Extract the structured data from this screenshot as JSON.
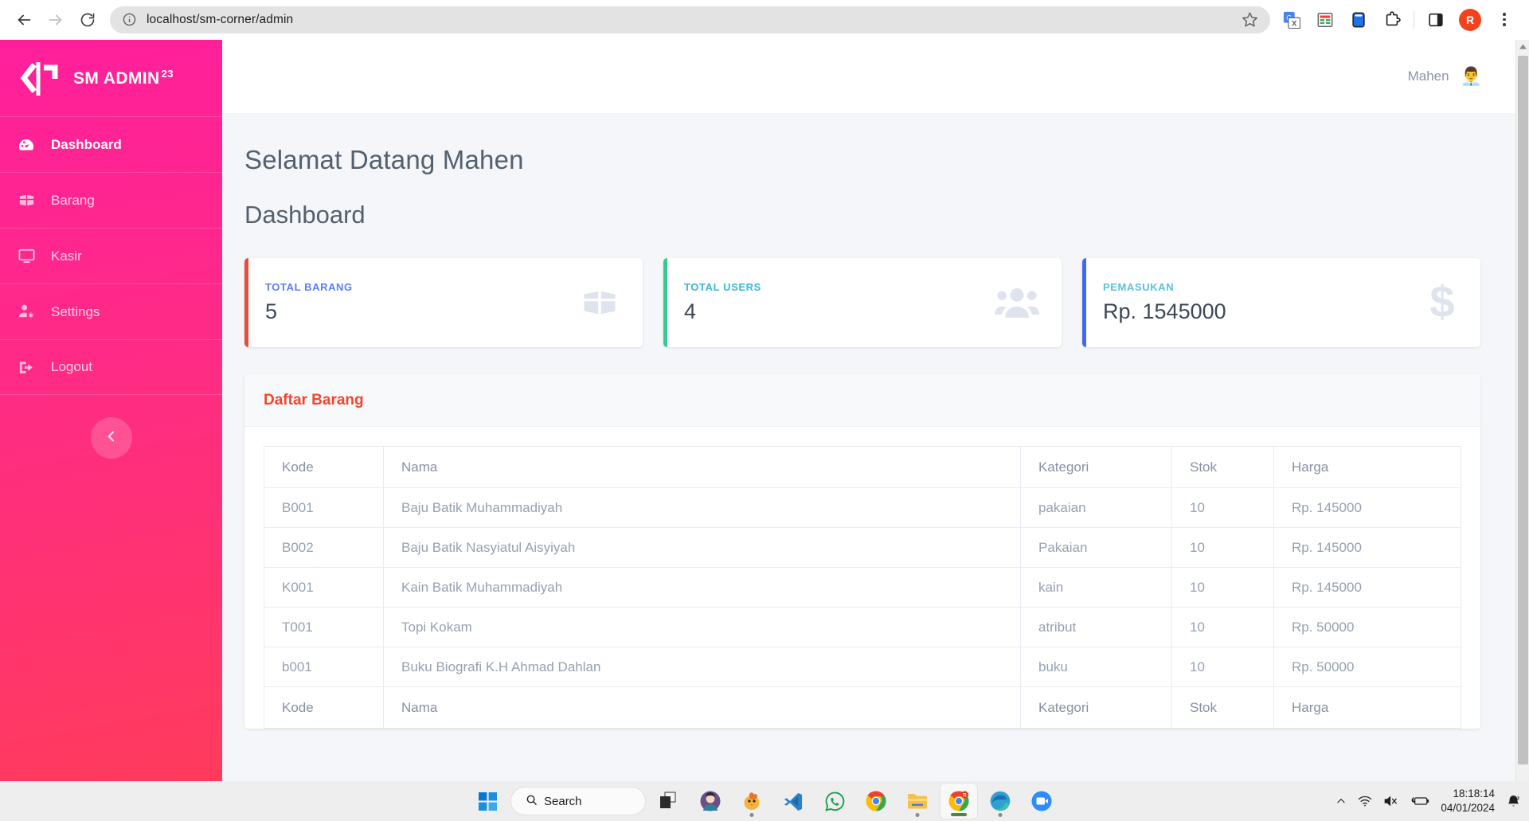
{
  "browser": {
    "url": "localhost/sm-corner/admin",
    "back_icon": "back-arrow-icon",
    "forward_icon": "forward-arrow-icon",
    "reload_icon": "reload-icon",
    "site_info_icon": "site-information-icon",
    "bookmark_icon": "star-icon",
    "extensions": [
      {
        "name": "google-translate-extension-icon"
      },
      {
        "name": "spreadsheet-extension-icon"
      },
      {
        "name": "device-extension-icon"
      },
      {
        "name": "extensions-puzzle-icon"
      },
      {
        "name": "side-panel-icon"
      }
    ],
    "profile_initial": "R",
    "menu_icon": "three-dot-menu-icon"
  },
  "sidebar": {
    "brand": {
      "logo_icon": "code-brackets-logo-icon",
      "name": "SM ADMIN",
      "sup": "23"
    },
    "items": [
      {
        "label": "Dashboard",
        "icon": "dashboard-gauge-icon",
        "active": true
      },
      {
        "label": "Barang",
        "icon": "box-icon",
        "active": false
      },
      {
        "label": "Kasir",
        "icon": "monitor-icon",
        "active": false
      },
      {
        "label": "Settings",
        "icon": "user-gear-icon",
        "active": false
      },
      {
        "label": "Logout",
        "icon": "logout-arrow-icon",
        "active": false
      }
    ],
    "collapse_icon": "chevron-left-icon",
    "gradient_from": "#ff1f9c",
    "gradient_to": "#ff3b5c"
  },
  "topbar": {
    "user_name": "Mahen",
    "avatar_icon": "business-person-avatar-icon"
  },
  "main": {
    "welcome": "Selamat Datang Mahen",
    "page_title": "Dashboard",
    "cards": [
      {
        "label": "TOTAL BARANG",
        "value": "5",
        "accent": "#e74c3c",
        "label_color": "#5c7cfa",
        "icon": "box-icon"
      },
      {
        "label": "TOTAL USERS",
        "value": "4",
        "accent": "#2ecc8f",
        "label_color": "#3ab7d8",
        "icon": "users-group-icon"
      },
      {
        "label": "PEMASUKAN",
        "value": "Rp. 1545000",
        "accent": "#4267f0",
        "label_color": "#5bc0de",
        "icon": "dollar-sign-icon"
      }
    ],
    "panel": {
      "title": "Daftar Barang",
      "columns": [
        "Kode",
        "Nama",
        "Kategori",
        "Stok",
        "Harga"
      ],
      "rows": [
        [
          "B001",
          "Baju Batik Muhammadiyah",
          "pakaian",
          "10",
          "Rp. 145000"
        ],
        [
          "B002",
          "Baju Batik Nasyiatul Aisyiyah",
          "Pakaian",
          "10",
          "Rp. 145000"
        ],
        [
          "K001",
          "Kain Batik Muhammadiyah",
          "kain",
          "10",
          "Rp. 145000"
        ],
        [
          "T001",
          "Topi Kokam",
          "atribut",
          "10",
          "Rp. 50000"
        ],
        [
          "b001",
          "Buku Biografi K.H Ahmad Dahlan",
          "buku",
          "10",
          "Rp. 50000"
        ]
      ],
      "footer": [
        "Kode",
        "Nama",
        "Kategori",
        "Stok",
        "Harga"
      ]
    }
  },
  "taskbar": {
    "start_icon": "windows-start-icon",
    "search_label": "Search",
    "search_icon": "search-icon",
    "apps": [
      {
        "name": "task-view-icon",
        "state": "idle"
      },
      {
        "name": "character-app-icon",
        "state": "idle"
      },
      {
        "name": "chick-app-icon",
        "state": "running"
      },
      {
        "name": "vscode-icon",
        "state": "idle"
      },
      {
        "name": "whatsapp-icon",
        "state": "idle"
      },
      {
        "name": "chrome-icon",
        "state": "idle"
      },
      {
        "name": "file-explorer-icon",
        "state": "running"
      },
      {
        "name": "chrome-active-icon",
        "state": "active"
      },
      {
        "name": "edge-icon",
        "state": "running"
      },
      {
        "name": "zoom-icon",
        "state": "idle"
      }
    ],
    "tray": {
      "overflow_icon": "chevron-up-icon",
      "wifi_icon": "wifi-icon",
      "volume_icon": "volume-muted-icon",
      "battery_icon": "battery-saver-icon",
      "notification_icon": "notification-bell-dnd-icon"
    },
    "time": "18:18:14",
    "date": "04/01/2024"
  }
}
